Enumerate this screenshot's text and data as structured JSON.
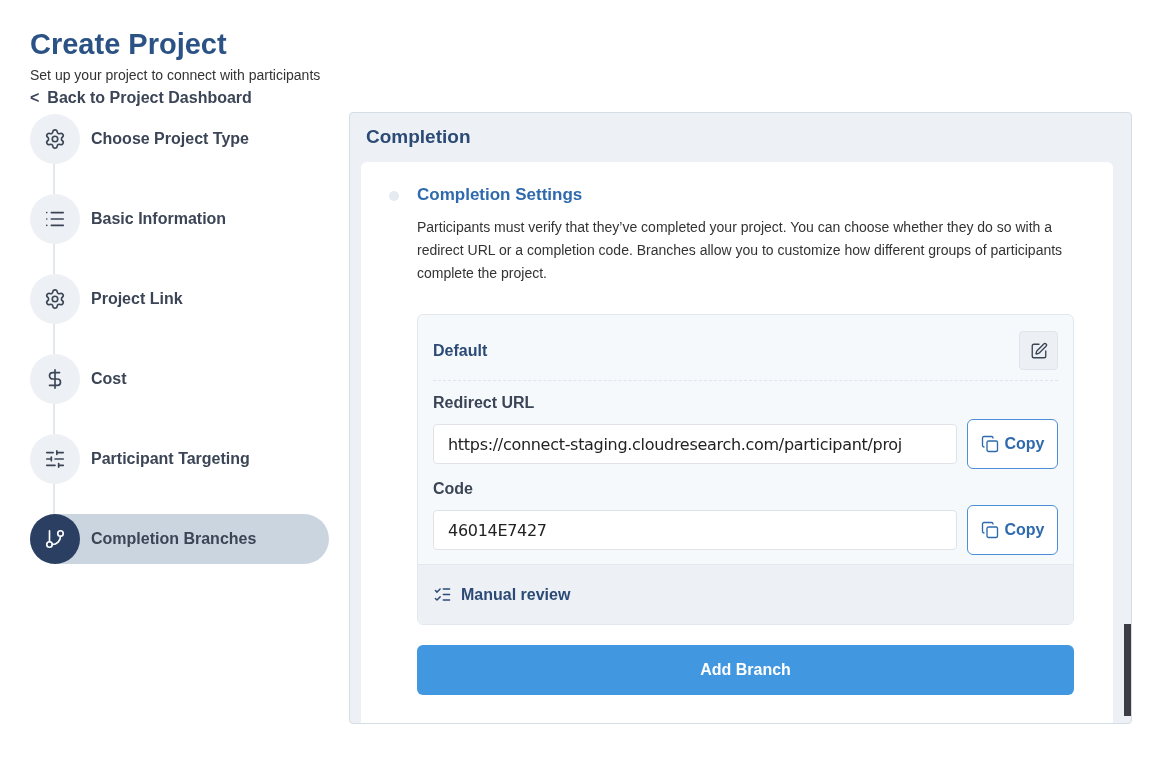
{
  "header": {
    "title": "Create Project",
    "subtitle": "Set up your project to connect with participants",
    "back_link": {
      "icon": "<",
      "label": "Back to Project Dashboard"
    }
  },
  "steps": [
    {
      "label": "Choose Project Type",
      "kind": "gear",
      "selected": false
    },
    {
      "label": "Basic Information",
      "kind": "list",
      "selected": false
    },
    {
      "label": "Project Link",
      "kind": "gear",
      "selected": false
    },
    {
      "label": "Cost",
      "kind": "dollar",
      "selected": false
    },
    {
      "label": "Participant Targeting",
      "kind": "sliders",
      "selected": false
    },
    {
      "label": "Completion Branches",
      "kind": "branch",
      "selected": true
    }
  ],
  "panel": {
    "title": "Completion",
    "section": {
      "title": "Completion Settings",
      "description": "Participants must verify that they’ve completed your project. You can choose whether they do so with a redirect URL or a completion code. Branches allow you to customize how different groups of participants complete the project.",
      "branch": {
        "name": "Default",
        "fields": [
          {
            "label": "Redirect URL",
            "value": "https://connect-staging.cloudresearch.com/participant/proj",
            "button": "Copy"
          },
          {
            "label": "Code",
            "value": "46014E7427",
            "button": "Copy"
          }
        ],
        "footer": "Manual review"
      },
      "add_button": "Add Branch"
    }
  }
}
